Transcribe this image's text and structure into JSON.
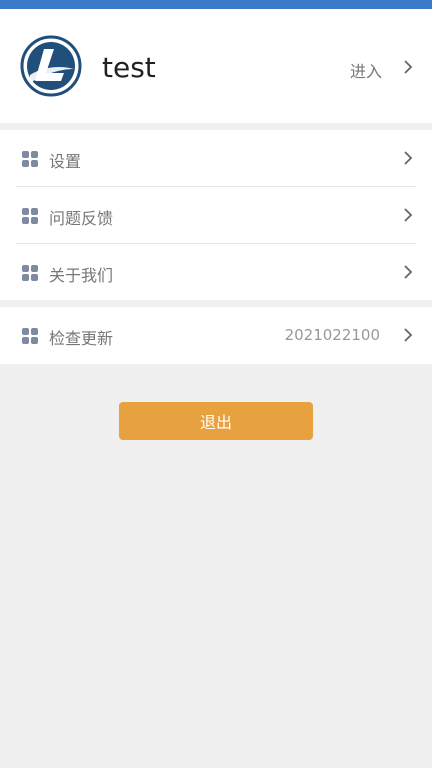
{
  "profile": {
    "username": "test",
    "enter_label": "进入"
  },
  "menu": {
    "items": [
      {
        "label": "设置"
      },
      {
        "label": "问题反馈"
      },
      {
        "label": "关于我们"
      }
    ],
    "update": {
      "label": "检查更新",
      "version": "2021022100"
    }
  },
  "actions": {
    "logout_label": "退出"
  },
  "colors": {
    "topbar": "#3a78c8",
    "logout_button": "#e8a13f",
    "icon": "#7d8aa0"
  },
  "icons": {
    "logo": "logo-icon",
    "row": "grid-icon",
    "arrow": "chevron-right-icon"
  }
}
